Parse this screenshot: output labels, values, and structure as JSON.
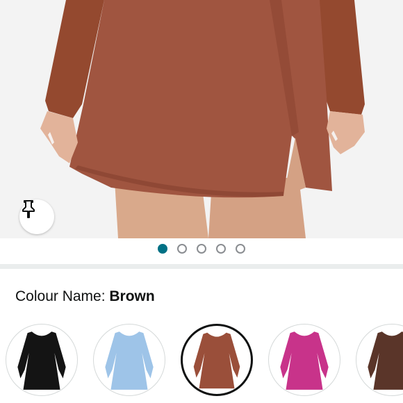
{
  "product": {
    "image_alt": "Brown long sleeve dress"
  },
  "gallery": {
    "total_images": 5,
    "active_index": 0
  },
  "pin_button": {
    "icon": "pin-icon"
  },
  "colour": {
    "label": "Colour Name: ",
    "selected": "Brown"
  },
  "swatches": [
    {
      "name": "Black",
      "color": "#141414",
      "selected": false
    },
    {
      "name": "Light Blue",
      "color": "#9ec4e8",
      "selected": false
    },
    {
      "name": "Brown",
      "color": "#9a4f3a",
      "selected": true
    },
    {
      "name": "Pink",
      "color": "#c8338a",
      "selected": false
    },
    {
      "name": "Coffee",
      "color": "#5a3529",
      "selected": false
    }
  ],
  "colors": {
    "accent": "#007185",
    "dress": "#9a4f3a",
    "skin": "#d9a98b",
    "background": "#f3f3f3"
  }
}
